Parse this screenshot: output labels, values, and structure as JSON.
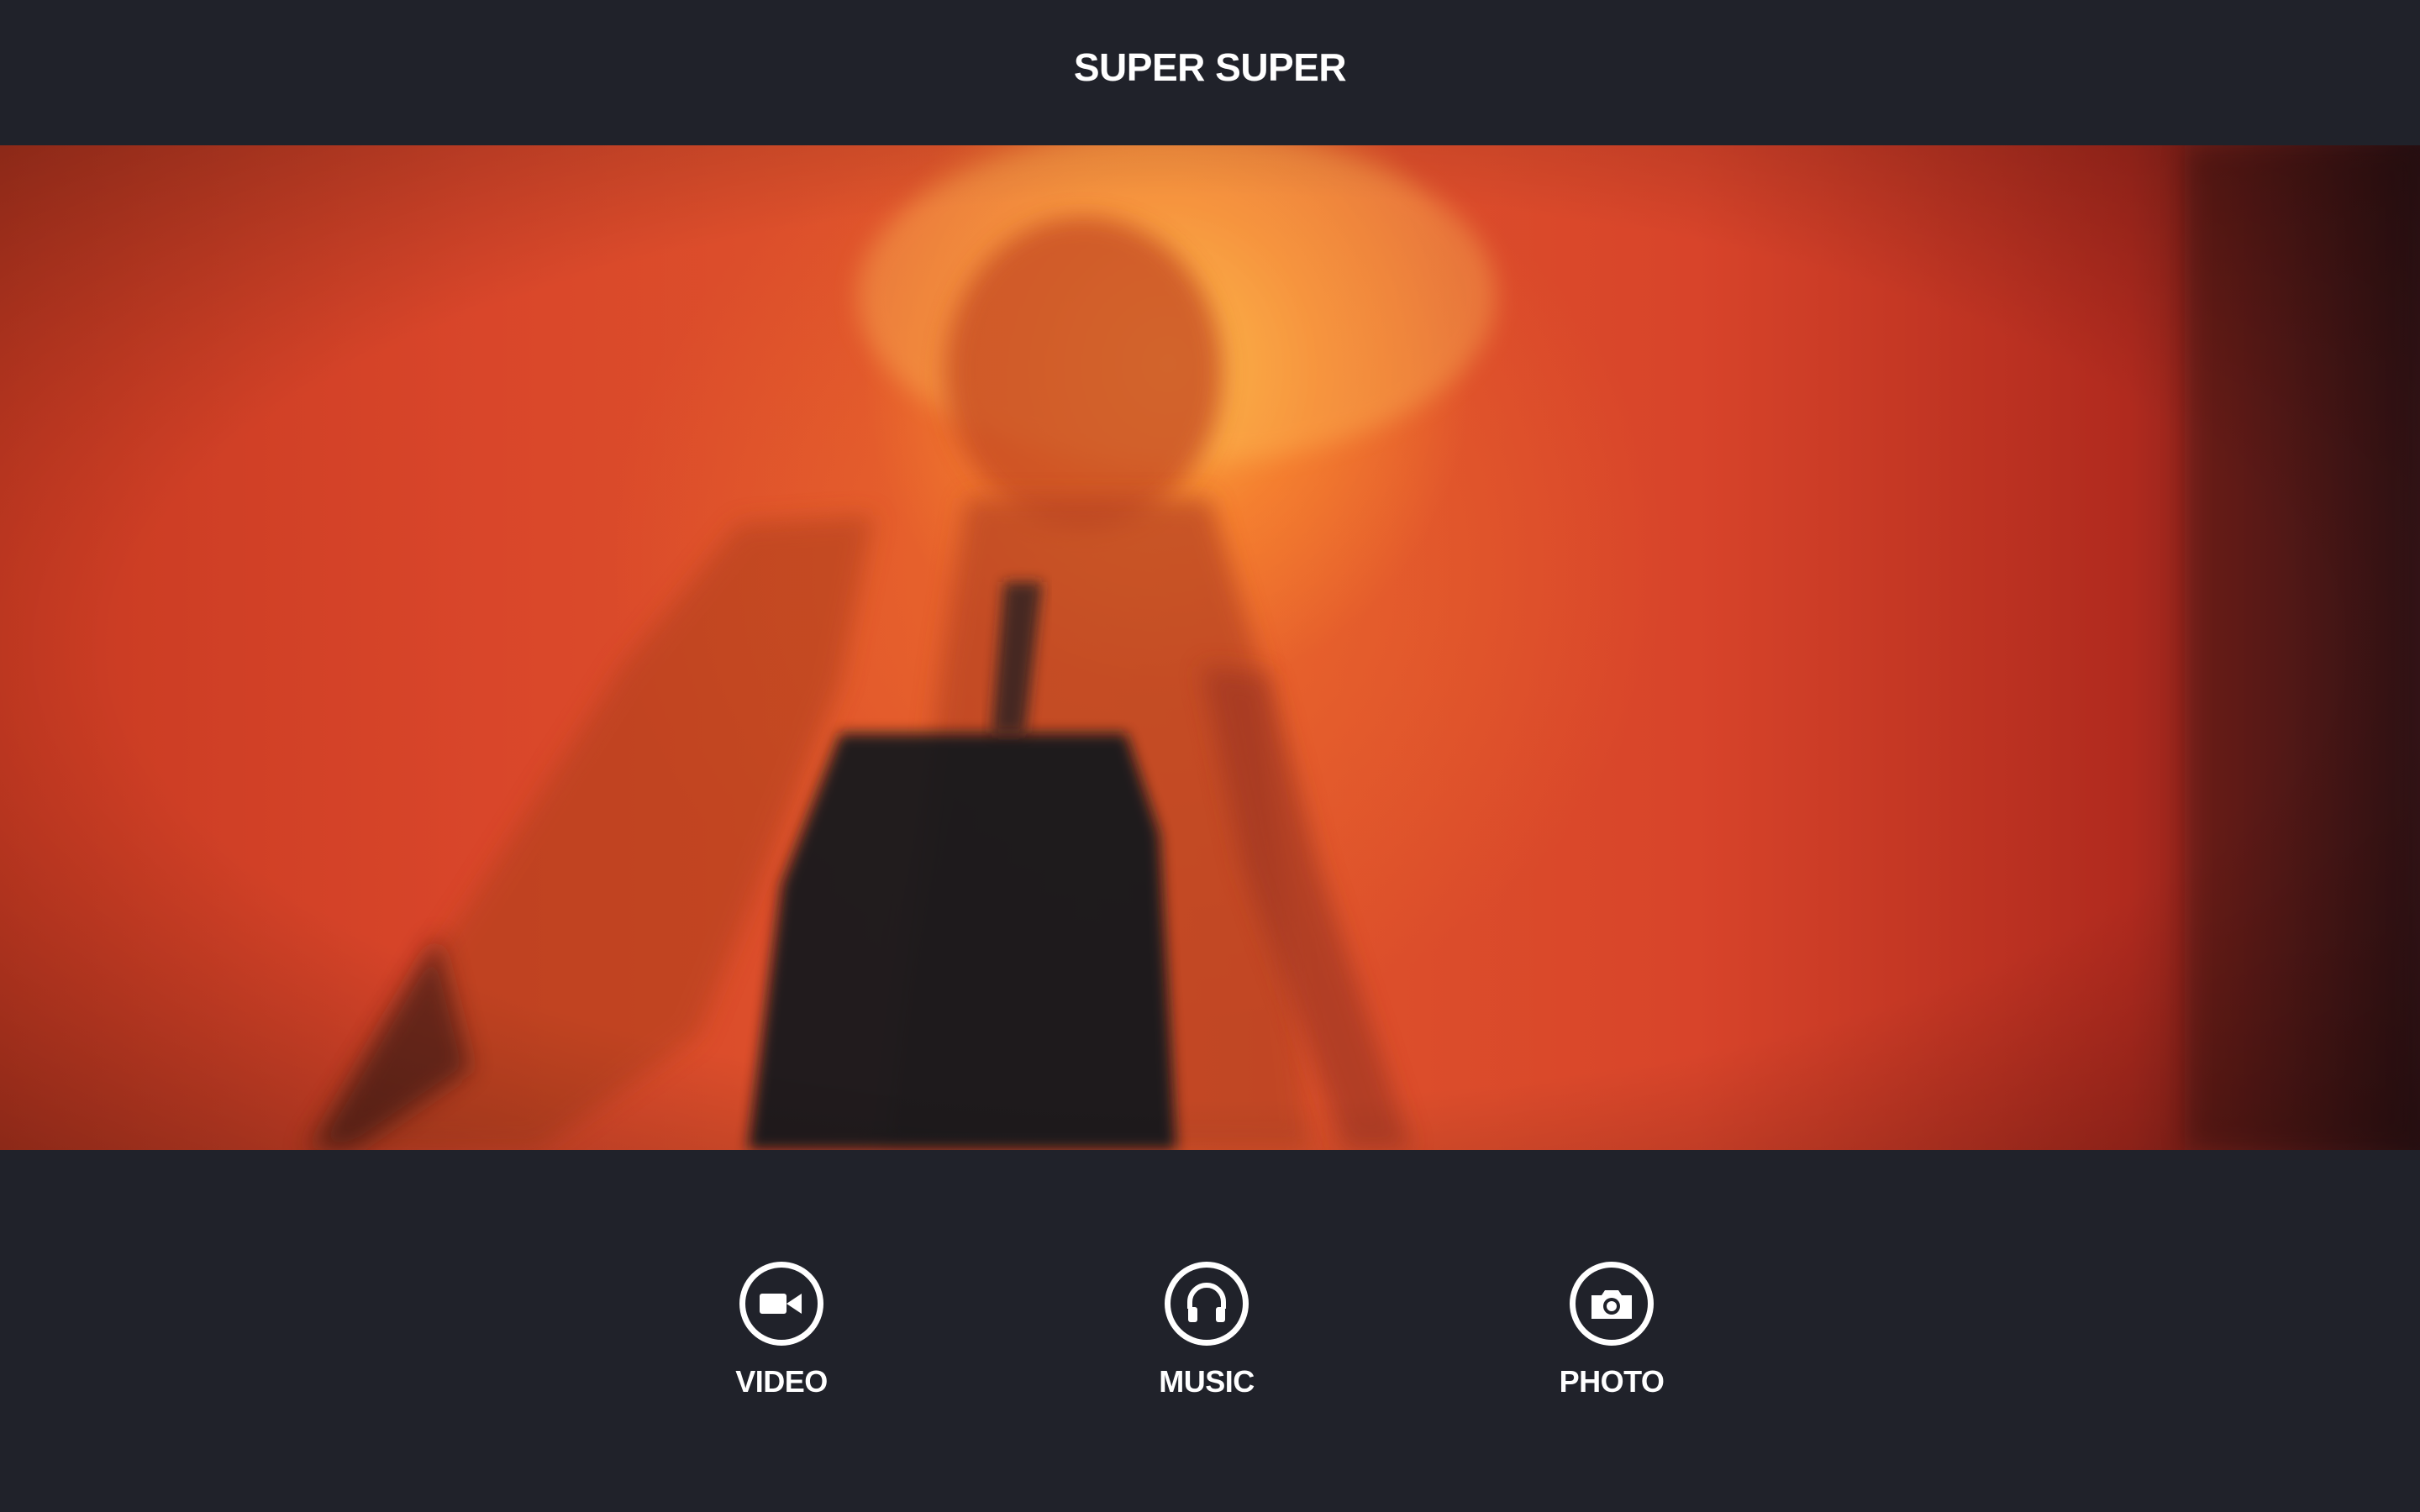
{
  "header": {
    "brand": "SUPER SUPER"
  },
  "hero": {
    "image_description_icon": "hero-photo"
  },
  "nav": {
    "items": [
      {
        "label": "VIDEO",
        "icon": "video-camera-icon"
      },
      {
        "label": "MUSIC",
        "icon": "headphones-icon"
      },
      {
        "label": "PHOTO",
        "icon": "camera-icon"
      }
    ]
  },
  "colors": {
    "background": "#20222a",
    "text": "#ffffff",
    "hero_red": "#d9462a",
    "hero_orange": "#ffbe46"
  }
}
